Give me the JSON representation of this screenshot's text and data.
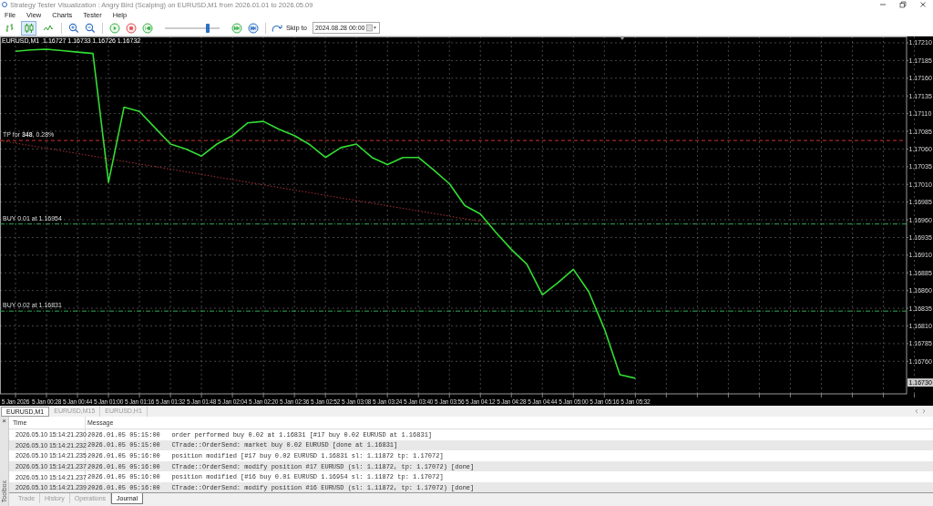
{
  "window": {
    "title": "Strategy Tester Visualization : Angry Bird (Scalping) on EURUSD,M1 from 2026.01.01 to 2026.05.09"
  },
  "menu": [
    "File",
    "View",
    "Charts",
    "Tester",
    "Help"
  ],
  "toolbar": {
    "chart_types": [
      {
        "kind": "bars",
        "selected": false
      },
      {
        "kind": "candles",
        "selected": true
      },
      {
        "kind": "line",
        "selected": false
      }
    ],
    "speed": {
      "level": 0.78
    },
    "skip_label": "Skip to",
    "skip_date": "2024.08.28 00:00"
  },
  "chart": {
    "header": "EURUSD,M1  1.16727 1.16733 1.16726 1.16732",
    "current_price": "1.16730",
    "chart_data": {
      "type": "line",
      "grid": true,
      "categories": [
        "5 Jan 2026",
        null,
        "5 Jan 00:28",
        null,
        "5 Jan 00:44",
        null,
        "5 Jan 01:00",
        null,
        "5 Jan 01:16",
        null,
        "5 Jan 01:32",
        null,
        "5 Jan 01:48",
        null,
        "5 Jan 02:04",
        null,
        "5 Jan 02:20",
        null,
        "5 Jan 02:36",
        null,
        "5 Jan 02:52",
        null,
        "5 Jan 03:08",
        null,
        "5 Jan 03:24",
        null,
        "5 Jan 03:40",
        null,
        "5 Jan 03:56",
        null,
        "5 Jan 04:12",
        null,
        "5 Jan 04:28",
        null,
        "5 Jan 04:44",
        null,
        "5 Jan 05:00",
        null,
        "5 Jan 05:16",
        null,
        "5 Jan 05:32",
        null,
        null,
        null,
        null,
        null,
        null,
        null,
        null,
        null,
        null,
        null,
        null,
        null,
        null,
        null,
        null,
        null,
        null
      ],
      "series": [
        {
          "color": "#33dd33",
          "values": [
            1.17198,
            1.172,
            1.17201,
            1.17199,
            1.17197,
            1.17195,
            1.17013,
            1.17119,
            1.17113,
            1.1709,
            1.17067,
            1.1706,
            1.1705,
            1.17067,
            1.17079,
            1.17097,
            1.17099,
            1.17088,
            1.17079,
            1.17066,
            1.17048,
            1.17062,
            1.17067,
            1.17048,
            1.17038,
            1.17048,
            1.17048,
            1.1703,
            1.17011,
            1.1698,
            1.16968,
            1.16942,
            1.16918,
            1.16897,
            1.16854,
            1.16871,
            1.1689,
            1.16858,
            1.16806,
            1.16741,
            1.16736,
            null,
            null,
            null,
            null,
            null,
            null,
            null,
            null,
            null,
            null,
            null,
            null,
            null,
            null,
            null,
            null,
            null,
            null
          ]
        }
      ],
      "ylim": [
        1.16714,
        1.17219
      ],
      "ref_lines": [
        {
          "axis": "y",
          "value": 1.17072,
          "label": "TP for **348**, 0.28%",
          "color": "#cc3333"
        },
        {
          "axis": "y",
          "value": 1.16954,
          "label": "BUY 0.01 at 1.16954",
          "color": "#33aa55"
        },
        {
          "axis": "y",
          "value": 1.16831,
          "label": "BUY 0.02 at 1.16831",
          "color": "#33aa55"
        }
      ],
      "yticks": [
        {
          "value": 1.1721,
          "label": "1.17210"
        },
        {
          "value": 1.17185,
          "label": "1.17185"
        },
        {
          "value": 1.1716,
          "label": "1.17160"
        },
        {
          "value": 1.17135,
          "label": "1.17135"
        },
        {
          "value": 1.1711,
          "label": "1.17110"
        },
        {
          "value": 1.17085,
          "label": "1.17085"
        },
        {
          "value": 1.1706,
          "label": "1.17060"
        },
        {
          "value": 1.17035,
          "label": "1.17035"
        },
        {
          "value": 1.1701,
          "label": "1.17010"
        },
        {
          "value": 1.16985,
          "label": "1.16985"
        },
        {
          "value": 1.1696,
          "label": "1.16960"
        },
        {
          "value": 1.16935,
          "label": "1.16935"
        },
        {
          "value": 1.1691,
          "label": "1.16910"
        },
        {
          "value": 1.16885,
          "label": "1.16885"
        },
        {
          "value": 1.1686,
          "label": "1.16860"
        },
        {
          "value": 1.16835,
          "label": "1.16835"
        },
        {
          "value": 1.1681,
          "label": "1.16810"
        },
        {
          "value": 1.16785,
          "label": "1.16785"
        },
        {
          "value": 1.1676,
          "label": "1.16760"
        }
      ]
    }
  },
  "chart_tabs": [
    {
      "label": "EURUSD,M1",
      "selected": true
    },
    {
      "label": "EURUSD,M15",
      "selected": false
    },
    {
      "label": "EURUSD,H1",
      "selected": false
    }
  ],
  "toolbox": {
    "title": "Toolbox",
    "close": "×"
  },
  "journal": {
    "columns": [
      "Time",
      "Message"
    ],
    "rows": [
      {
        "time": "2026.05.10 15:14:21.230",
        "message": "2026.01.05 05:15:00   order performed buy 0.02 at 1.16831 [#17 buy 0.02 EURUSD at 1.16831]"
      },
      {
        "time": "2026.05.10 15:14:21.232",
        "message": "2026.01.05 05:15:00   CTrade::OrderSend: market buy 0.02 EURUSD [done at 1.16831]"
      },
      {
        "time": "2026.05.10 15:14:21.235",
        "message": "2026.01.05 05:16:00   position modified [#17 buy 0.02 EURUSD 1.16831 sl: 1.11872 tp: 1.17072]"
      },
      {
        "time": "2026.05.10 15:14:21.237",
        "message": "2026.01.05 05:16:00   CTrade::OrderSend: modify position #17 EURUSD (sl: 1.11872, tp: 1.17072) [done]"
      },
      {
        "time": "2026.05.10 15:14:21.237",
        "message": "2026.01.05 05:16:00   position modified [#16 buy 0.01 EURUSD 1.16954 sl: 1.11872 tp: 1.17072]"
      },
      {
        "time": "2026.05.10 15:14:21.239",
        "message": "2026.01.05 05:16:00   CTrade::OrderSend: modify position #16 EURUSD (sl: 1.11872, tp: 1.17072) [done]"
      }
    ]
  },
  "bottom_tabs": [
    {
      "label": "Trade",
      "selected": false
    },
    {
      "label": "History",
      "selected": false
    },
    {
      "label": "Operations",
      "selected": false
    },
    {
      "label": "Journal",
      "selected": true
    }
  ]
}
